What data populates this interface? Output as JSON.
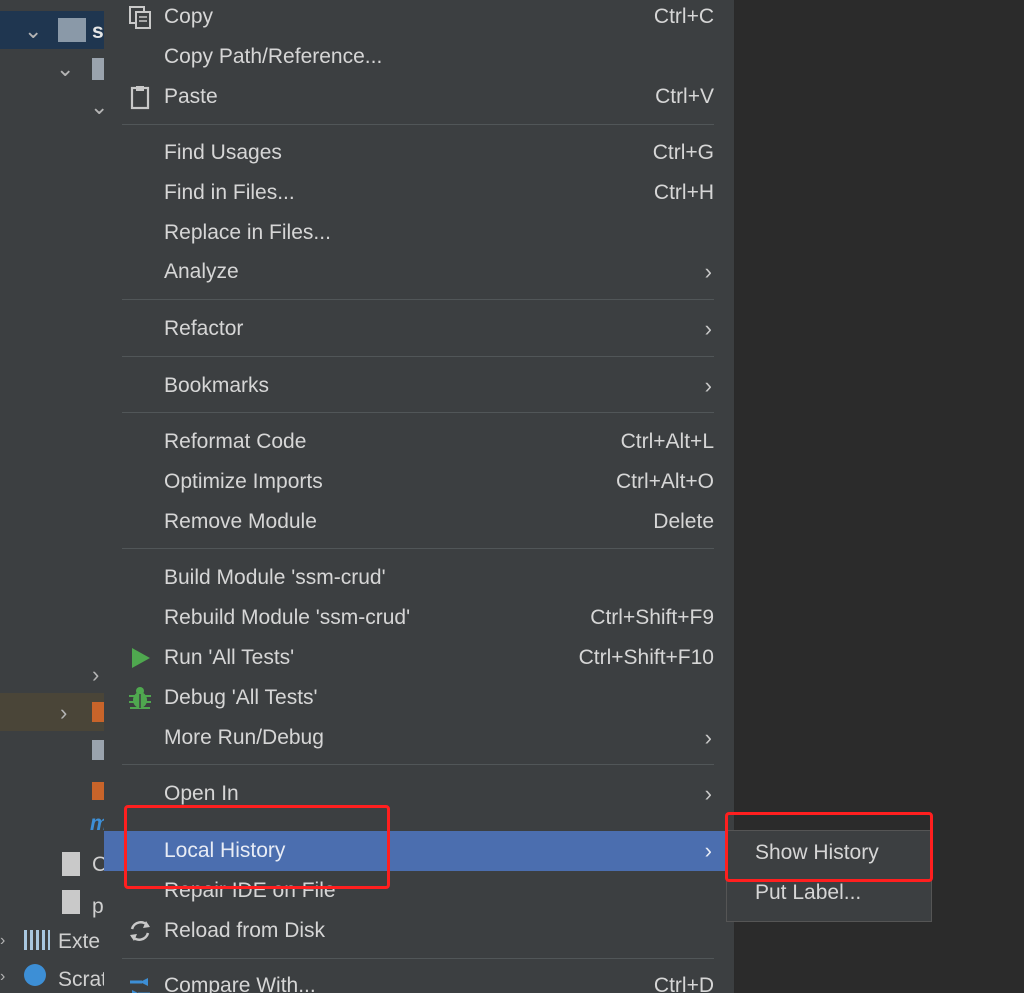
{
  "project_tree": {
    "rows": [
      {
        "text": "s"
      },
      {
        "text": "C"
      },
      {
        "text": "p"
      },
      {
        "text": "Exte"
      },
      {
        "text": "Scrat"
      }
    ]
  },
  "menu": {
    "items": [
      {
        "label": "Copy",
        "shortcut": "Ctrl+C",
        "icon": "copy-icon"
      },
      {
        "label": "Copy Path/Reference...",
        "shortcut": ""
      },
      {
        "label": "Paste",
        "shortcut": "Ctrl+V",
        "icon": "paste-icon"
      },
      {
        "label": "Find Usages",
        "shortcut": "Ctrl+G"
      },
      {
        "label": "Find in Files...",
        "shortcut": "Ctrl+H"
      },
      {
        "label": "Replace in Files...",
        "shortcut": ""
      },
      {
        "label": "Analyze",
        "submenu": true
      },
      {
        "label": "Refactor",
        "submenu": true
      },
      {
        "label": "Bookmarks",
        "submenu": true
      },
      {
        "label": "Reformat Code",
        "shortcut": "Ctrl+Alt+L"
      },
      {
        "label": "Optimize Imports",
        "shortcut": "Ctrl+Alt+O"
      },
      {
        "label": "Remove Module",
        "shortcut": "Delete"
      },
      {
        "label": "Build Module 'ssm-crud'",
        "shortcut": ""
      },
      {
        "label": "Rebuild Module 'ssm-crud'",
        "shortcut": "Ctrl+Shift+F9"
      },
      {
        "label": "Run 'All Tests'",
        "shortcut": "Ctrl+Shift+F10",
        "icon": "run-icon"
      },
      {
        "label": "Debug 'All Tests'",
        "shortcut": "",
        "icon": "debug-bug-icon"
      },
      {
        "label": "More Run/Debug",
        "submenu": true
      },
      {
        "label": "Open In",
        "submenu": true
      },
      {
        "label": "Local History",
        "submenu": true,
        "active": true
      },
      {
        "label": "Repair IDE on File",
        "shortcut": ""
      },
      {
        "label": "Reload from Disk",
        "shortcut": "",
        "icon": "reload-icon"
      },
      {
        "label": "Compare With...",
        "shortcut": "Ctrl+D",
        "icon": "compare-icon"
      }
    ]
  },
  "submenu": {
    "items": [
      {
        "label": "Show History"
      },
      {
        "label": "Put Label..."
      }
    ]
  },
  "colors": {
    "menu_bg": "#3c3f41",
    "active_bg": "#4b6eaf",
    "highlight_box": "#ff1f1f"
  }
}
